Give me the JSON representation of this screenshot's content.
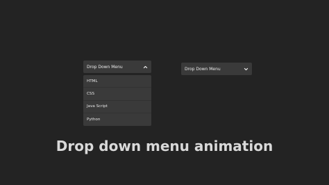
{
  "dropdown_open": {
    "label": "Drop Down Menu",
    "chevron_icon": "chevron-up-icon",
    "items": [
      {
        "label": "HTML"
      },
      {
        "label": "CSS"
      },
      {
        "label": "Java Script"
      },
      {
        "label": "Python"
      }
    ]
  },
  "dropdown_closed": {
    "label": "Drop Down Menu",
    "chevron_icon": "chevron-down-icon"
  },
  "caption": "Drop down menu animation",
  "colors": {
    "background": "#232323",
    "control": "#3a3a3a",
    "text": "#ececec",
    "caption": "#d9d9d9"
  }
}
